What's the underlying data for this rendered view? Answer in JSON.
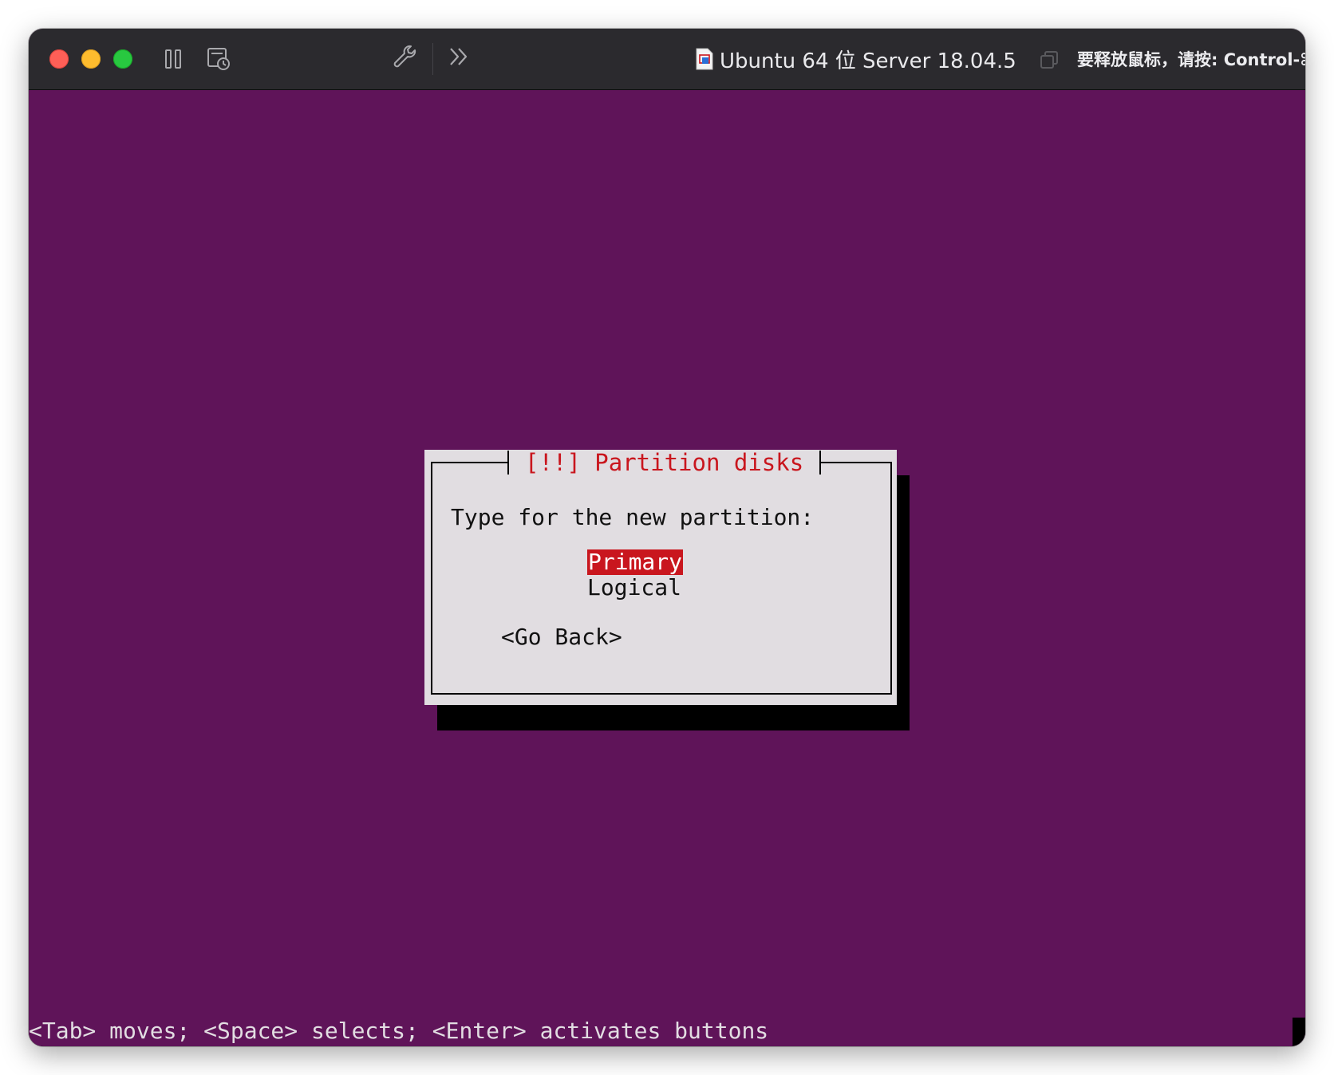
{
  "window": {
    "title": "Ubuntu 64 位 Server 18.04.5",
    "release_hint": "要释放鼠标，请按: Control-⌘"
  },
  "toolbar": {
    "icons": [
      "pause-icon",
      "snapshot-icon",
      "wrench-icon",
      "chevrons-right-icon",
      "restore-window-icon"
    ]
  },
  "installer": {
    "dialog_title": "[!!] Partition disks",
    "question": "Type for the new partition:",
    "options": [
      "Primary",
      "Logical"
    ],
    "selected": "Primary",
    "go_back": "<Go Back>",
    "status_line": "<Tab> moves; <Space> selects; <Enter> activates buttons"
  },
  "colors": {
    "background": "#5f1459",
    "dialog": "#e1dde1",
    "highlight": "#c9161e",
    "titlebar": "#2b2a2e"
  }
}
